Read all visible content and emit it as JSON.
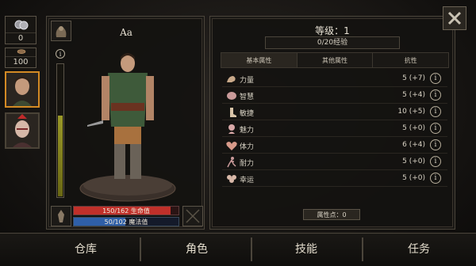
{
  "resources": {
    "silver": "0",
    "copper": "100"
  },
  "character": {
    "name": "Aa",
    "level_label": "等级：1",
    "exp_label": "0/20经验",
    "hp_label": "150/162 生命值",
    "mp_label": "50/102 魔法值",
    "hp_fraction": 0.926,
    "mp_fraction": 0.49,
    "xp_bar_fraction": 0.62
  },
  "tabs": [
    {
      "label": "基本属性",
      "active": true
    },
    {
      "label": "其他属性",
      "active": false
    },
    {
      "label": "抗性",
      "active": false
    }
  ],
  "stats": [
    {
      "name": "力量",
      "value": "5 (+7)",
      "icon": "muscle-icon"
    },
    {
      "name": "智慧",
      "value": "5 (+4)",
      "icon": "brain-icon"
    },
    {
      "name": "敏捷",
      "value": "10 (+5)",
      "icon": "foot-icon"
    },
    {
      "name": "魅力",
      "value": "5 (+0)",
      "icon": "charm-icon"
    },
    {
      "name": "体力",
      "value": "6 (+4)",
      "icon": "heart-icon"
    },
    {
      "name": "耐力",
      "value": "5 (+0)",
      "icon": "runner-icon"
    },
    {
      "name": "幸运",
      "value": "5 (+0)",
      "icon": "clover-icon"
    }
  ],
  "attribute_points": "属性点：0",
  "bottom_tabs": [
    "仓库",
    "角色",
    "技能",
    "任务"
  ],
  "colors": {
    "hp": "#c0302a",
    "mp": "#2f5fa8",
    "accent": "#d38a24",
    "xp": "#8c8a1e"
  }
}
